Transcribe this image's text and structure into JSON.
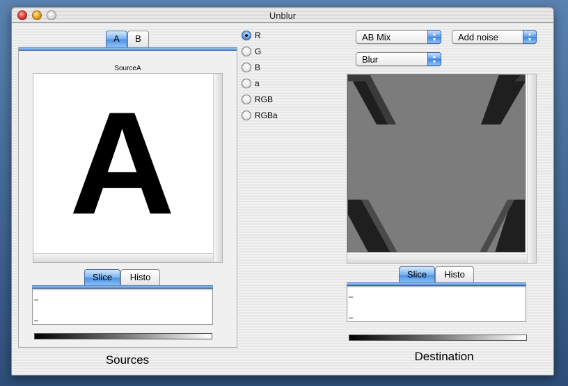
{
  "window": {
    "title": "Unblur"
  },
  "sources": {
    "tabs": [
      "A",
      "B"
    ],
    "caption": "SourceA",
    "image_letter": "A",
    "slice_tabs": [
      "Slice",
      "Histo"
    ],
    "slice_ticks": [
      "–",
      "–"
    ],
    "label": "Sources"
  },
  "channels": {
    "options": [
      "R",
      "G",
      "B",
      "a",
      "RGB",
      "RGBa"
    ],
    "selected": "R"
  },
  "destination": {
    "popup_mix": "AB Mix",
    "popup_noise": "Add noise",
    "popup_filter": "Blur",
    "slice_tabs": [
      "Slice",
      "Histo"
    ],
    "slice_ticks": [
      "–",
      "–"
    ],
    "label": "Destination"
  },
  "colors": {
    "accent": "#4c92e6",
    "desktop": "#3a5f86",
    "dest_background": "#7c7c7c"
  }
}
